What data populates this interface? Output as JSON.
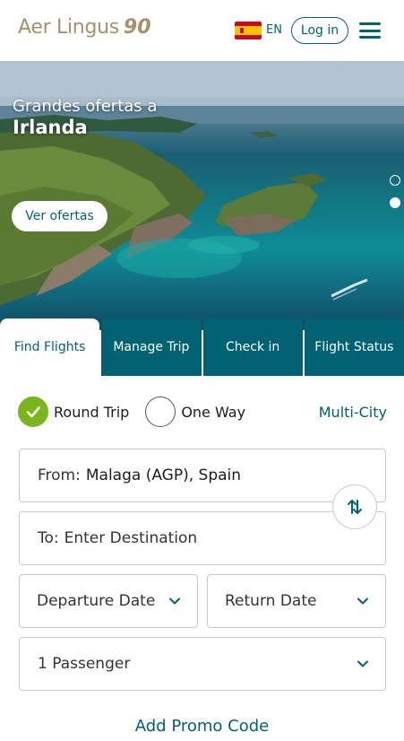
{
  "header": {
    "logo_text": "Aer Lingus",
    "logo_suffix": "90",
    "language": "EN",
    "login_label": "Log in",
    "flag_icon": "spain-flag-icon",
    "menu_icon": "hamburger-menu-icon"
  },
  "hero": {
    "title_line1": "Grandes ofertas a",
    "title_line2": "Irlanda",
    "cta_label": "Ver ofertas",
    "slides_count": 2,
    "active_slide": 2
  },
  "tabs": [
    {
      "label": "Find Flights",
      "active": true
    },
    {
      "label": "Manage Trip",
      "active": false
    },
    {
      "label": "Check in",
      "active": false
    },
    {
      "label": "Flight Status",
      "active": false
    }
  ],
  "trip_type": {
    "round_trip_label": "Round Trip",
    "one_way_label": "One Way",
    "multi_city_label": "Multi-City",
    "selected": "Round Trip"
  },
  "search": {
    "from_label": "From:",
    "from_value": "Malaga (AGP), Spain",
    "to_label": "To:",
    "to_placeholder": "Enter Destination",
    "departure_label": "Departure Date",
    "return_label": "Return Date",
    "passengers_label": "1 Passenger",
    "promo_label": "Add Promo Code"
  },
  "colors": {
    "brand_teal": "#006272",
    "brand_gold": "#a8906a",
    "check_green": "#7ab51d"
  }
}
